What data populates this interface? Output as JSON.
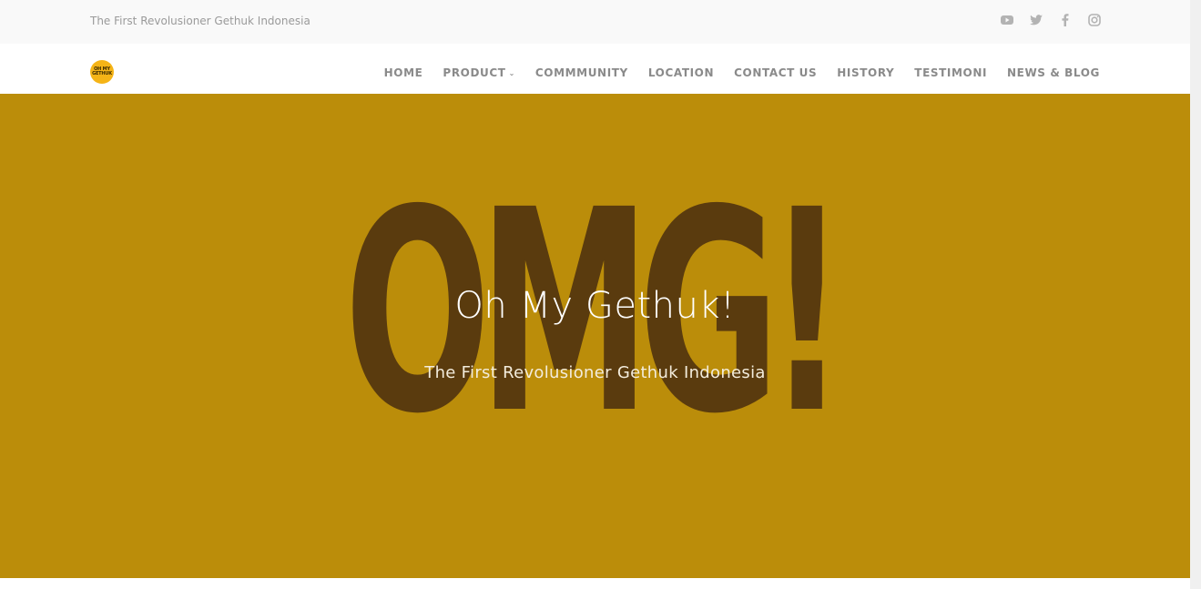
{
  "topbar": {
    "tagline": "The First Revolusioner Gethuk Indonesia",
    "social_icons": [
      "youtube-icon",
      "twitter-icon",
      "facebook-icon",
      "instagram-icon"
    ]
  },
  "navbar": {
    "logo_text": "OH MY GETHUK",
    "menu": [
      {
        "label": "HOME"
      },
      {
        "label": "PRODUCT",
        "has_dropdown": true
      },
      {
        "label": "COMMMUNITY"
      },
      {
        "label": "LOCATION"
      },
      {
        "label": "CONTACT US"
      },
      {
        "label": "HISTORY"
      },
      {
        "label": "TESTIMONI"
      },
      {
        "label": "NEWS & BLOG"
      }
    ]
  },
  "hero": {
    "background_text": "OMG!",
    "title": "Oh My Gethuk!",
    "subtitle": "The First Revolusioner Gethuk Indonesia",
    "background_color": "#bb8d0a",
    "text_color": "#5a3b0e"
  }
}
